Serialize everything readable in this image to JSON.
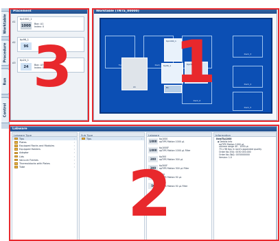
{
  "side_tabs": [
    "Worktable",
    "Procedure",
    "Run",
    "Control"
  ],
  "placement": {
    "title": "Placement",
    "items": [
      {
        "slot": "A1",
        "name": "tip1000_1",
        "value": "1000",
        "info": "Box: A1\nIndex: 0",
        "color": "#c8d2dc"
      },
      {
        "slot": "A2",
        "name": "tip96_1",
        "value": "96",
        "info": "",
        "color": "#cfe2f5"
      },
      {
        "slot": "A3",
        "name": "tip24_1",
        "value": "24",
        "info": "Box: A3\nIndex: 0",
        "color": "#cfe2f5"
      }
    ]
  },
  "worktable": {
    "title": "Worktable (TNTS_00000)",
    "main_label": "A1",
    "slots": [
      "Tip",
      "Rack_1",
      "Rack_2",
      "Rack_3",
      "Rack_4",
      "Rack_5",
      "Rack_6"
    ],
    "labware": [
      "tip1000_1",
      "tip96_1",
      "tip24_1",
      "B1"
    ]
  },
  "labware_panel": {
    "title": "Labware",
    "type_header": "Labware Type",
    "types": [
      "Tips",
      "Plates",
      "Equipped Racks and Modules",
      "Equipped Holders",
      "Adaptor",
      "Lids",
      "Vacuum Frames",
      "Thermoblocks with Plates",
      "Tube"
    ],
    "subtype_header": "Sub Type",
    "subtypes": [
      "Tips"
    ],
    "labware_header": "Labware",
    "items": [
      {
        "num": "1000",
        "text": "tip1000\nopTIPS Motion 1000 µL"
      },
      {
        "num": "1000",
        "text": "tip1000F\nopTIPS Motion 1000 µL Filter"
      },
      {
        "num": "300",
        "text": "tip300\nopTIPS Motion 300 µL"
      },
      {
        "num": "300",
        "text": "tip300F\nopTIPS Motion 300 µL Filter"
      },
      {
        "num": "50",
        "text": "tip50\nopTIPS Motion 50 µL"
      },
      {
        "num": "50",
        "text": "tip50F\nopTIPS Motion 50 µL Filter"
      }
    ],
    "info_header": "Information",
    "info_title": "itemTip1000",
    "info_lines": "  ▪ Details Info\n    epTIPS Motion 1000 µL\n    volume range 40 - 1000 µL\n    75 x 96 tips in rack's appended quality\n    Order No (EU): 0030 000.000\n    Order No (NA): 0030000000\n    Version: 1.0"
  },
  "callouts": [
    "1",
    "2",
    "3"
  ],
  "colors": {
    "callout": "#e8282c",
    "deck": "#0c4fb4",
    "header": "#1f4f8e"
  }
}
